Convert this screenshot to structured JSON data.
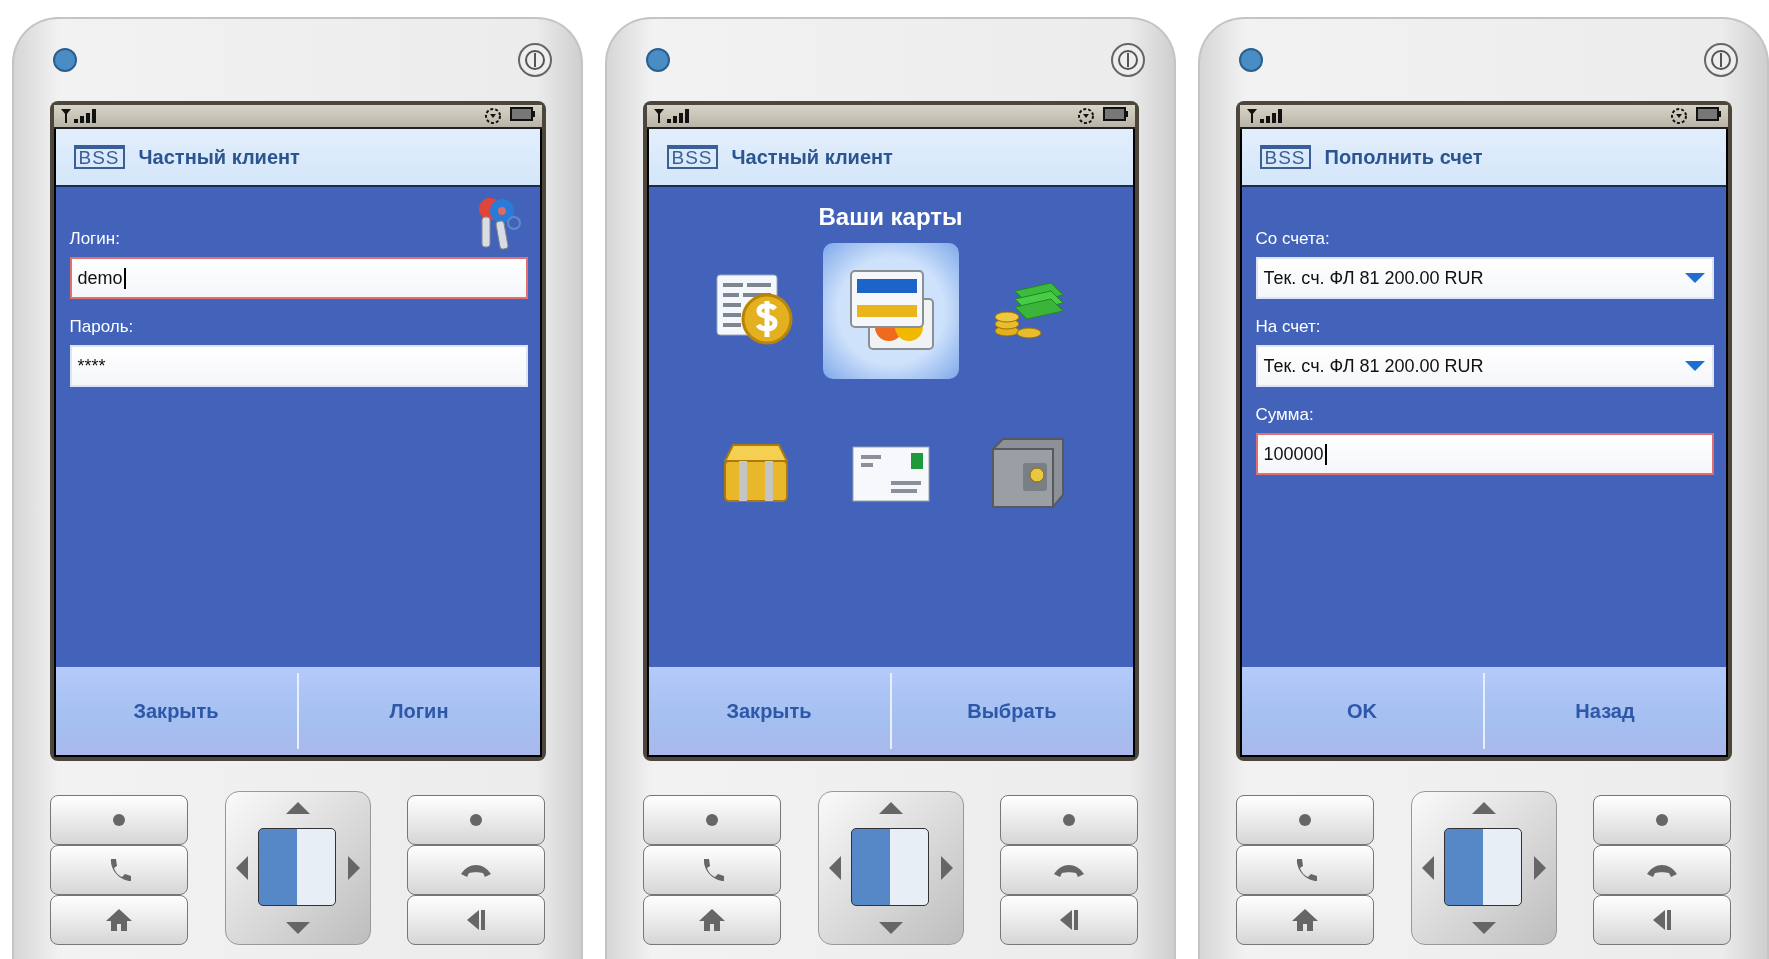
{
  "phones": [
    {
      "kind": "form",
      "logo": "BSS",
      "title": "Частный клиент",
      "show_keys_icon": true,
      "fields": [
        {
          "kind": "text",
          "label": "Логин:",
          "value": "demo",
          "focused": true
        },
        {
          "kind": "text",
          "label": "Пароль:",
          "value": "****",
          "focused": false
        }
      ],
      "softkeys": [
        "Закрыть",
        "Логин"
      ]
    },
    {
      "kind": "menu",
      "logo": "BSS",
      "title": "Частный клиент",
      "heading": "Ваши карты",
      "tiles": [
        {
          "selected": false
        },
        {
          "selected": true
        },
        {
          "selected": false
        },
        {
          "selected": false
        },
        {
          "selected": false
        },
        {
          "selected": false
        }
      ],
      "softkeys": [
        "Закрыть",
        "Выбрать"
      ]
    },
    {
      "kind": "form",
      "logo": "BSS",
      "title": "Пополнить счет",
      "fields": [
        {
          "kind": "select",
          "label": "Со счета:",
          "value": "Тек. сч. ФЛ 81  200.00 RUR",
          "focused": false
        },
        {
          "kind": "select",
          "label": "На счет:",
          "value": "Тек. сч. ФЛ 81  200.00 RUR",
          "focused": false
        },
        {
          "kind": "text",
          "label": "Сумма:",
          "value": "100000",
          "focused": true
        }
      ],
      "softkeys": [
        "OK",
        "Назад"
      ]
    }
  ]
}
